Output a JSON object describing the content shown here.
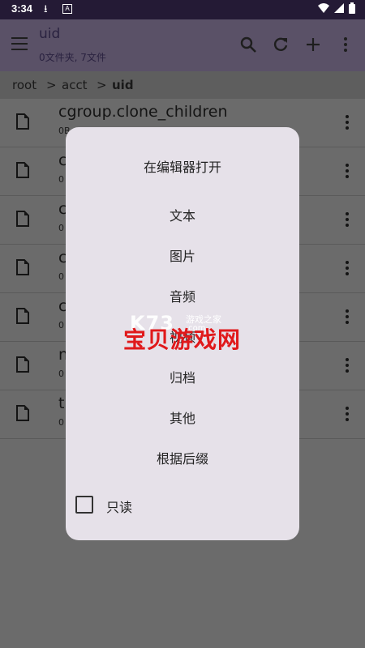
{
  "status": {
    "time": "3:34"
  },
  "appbar": {
    "title": "uid",
    "subtitle": "0文件夹, 7文件"
  },
  "breadcrumb": {
    "items": [
      "root",
      ">",
      "acct",
      ">",
      "uid"
    ]
  },
  "files": [
    {
      "name": "cgroup.clone_children",
      "meta": "0B"
    },
    {
      "name": "c",
      "meta": "0"
    },
    {
      "name": "c",
      "meta": "0"
    },
    {
      "name": "c",
      "meta": "0"
    },
    {
      "name": "c",
      "meta": "0"
    },
    {
      "name": "n",
      "meta": "0"
    },
    {
      "name": "t",
      "meta": "0"
    }
  ],
  "dialog": {
    "title": "在编辑器打开",
    "options": [
      "文本",
      "图片",
      "音频",
      "视频",
      "归档",
      "其他",
      "根据后缀"
    ],
    "readonly_label": "只读"
  },
  "watermark": {
    "logo": "K73",
    "line1": "游戏之家",
    "line2": ".com",
    "cn": "宝贝游戏网"
  }
}
